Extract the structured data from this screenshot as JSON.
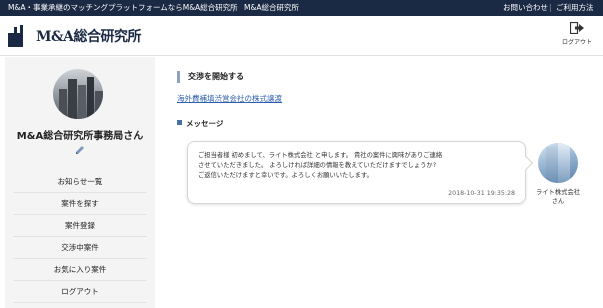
{
  "topbar": {
    "tagline": "M&A・事業承継のマッチングプラットフォームならM&A総合研究所",
    "separator": "|",
    "site_name": "M&A総合研究所",
    "contact": "お問い合わせ",
    "separator2": "|",
    "guide": "ご利用方法"
  },
  "header": {
    "logo_text": "M&A総合研究所",
    "logout_label": "ログアウト"
  },
  "sidebar": {
    "user_name": "M&A総合研究所事務局さん",
    "menu": [
      {
        "label": "お知らせ一覧"
      },
      {
        "label": "案件を探す"
      },
      {
        "label": "案件登録"
      },
      {
        "label": "交渉中案件"
      },
      {
        "label": "お気に入り案件"
      },
      {
        "label": "ログアウト"
      }
    ]
  },
  "main": {
    "section_title": "交渉を開始する",
    "deal_link": "海外費補填渋営会社の株式譲渡",
    "messages_title": "メッセージ",
    "message": {
      "body": "ご担当者様 初めまして、ライト株式会社 と申します。 貴社の案件に興味がありご連絡\nさせていただきました。 よろしければ詳細の情報を教えていただけますでしょうか?\nご返信いただけますと幸いです。よろしくお願いいたします。",
      "timestamp": "2018-10-31 19:35:28",
      "sender": "ライト株式会社\nさん"
    }
  },
  "icons": {
    "logout": "logout-icon",
    "edit": "pencil-icon",
    "messages": "square-bullet-icon"
  },
  "colors": {
    "topbar_bg": "#1b2a44",
    "brand_navy": "#1b2a44",
    "link_blue": "#2f5fb0",
    "accent_bar": "#8da2c0",
    "sidebar_bg": "#f4f4f4"
  }
}
